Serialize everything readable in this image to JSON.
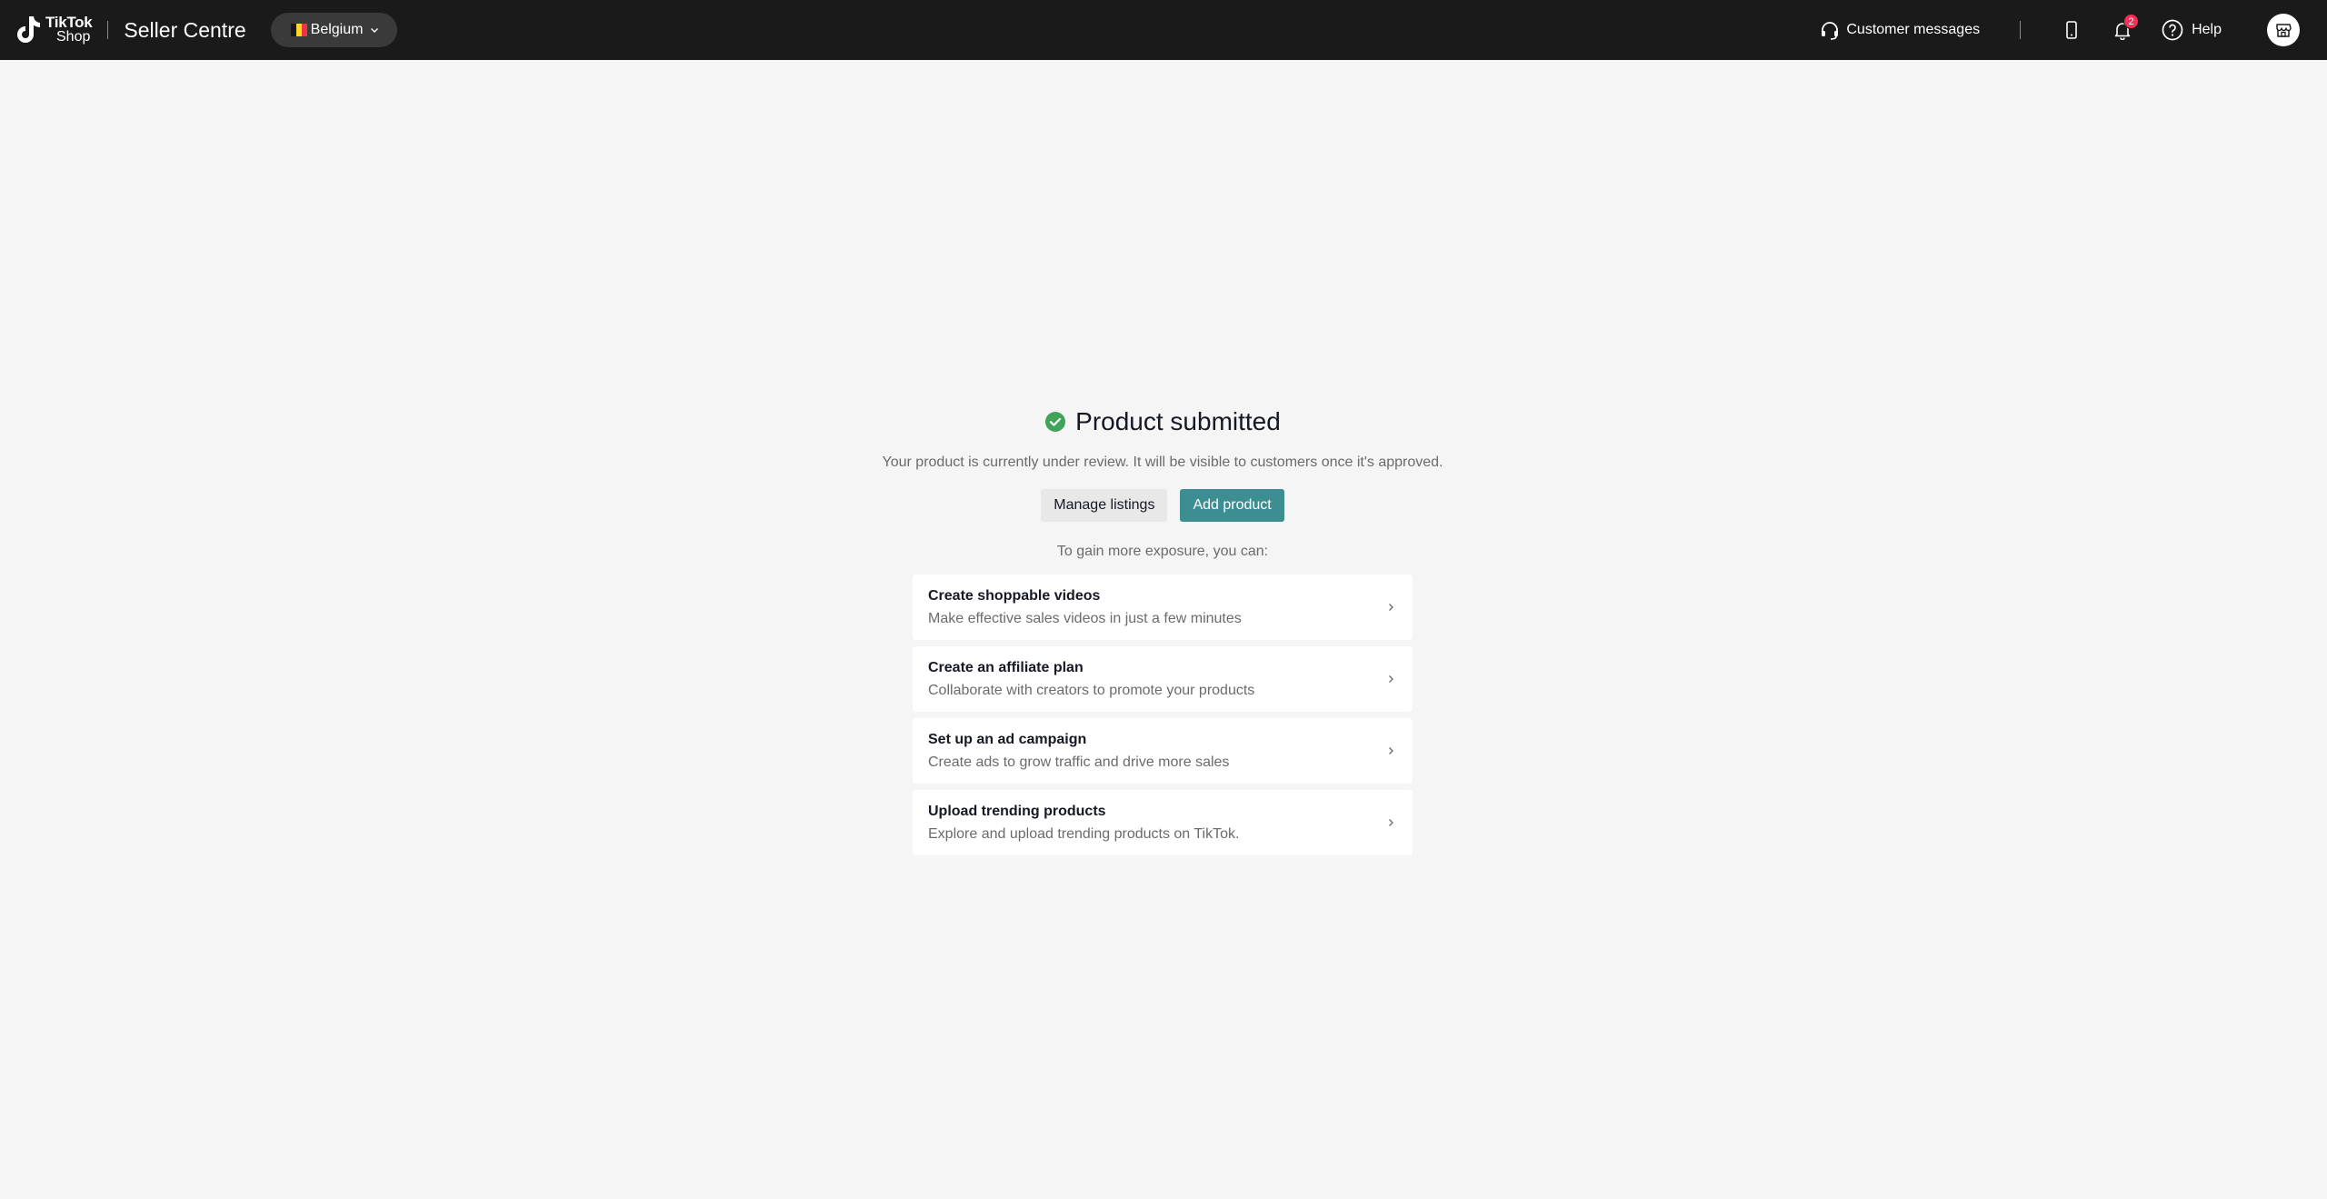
{
  "header": {
    "logo_line1": "TikTok",
    "logo_line2": "Shop",
    "title": "Seller Centre",
    "region": "Belgium",
    "customer_messages": "Customer messages",
    "notifications_count": "2",
    "help": "Help"
  },
  "main": {
    "title": "Product submitted",
    "subtitle": "Your product is currently under review. It will be visible to customers once it's approved.",
    "manage_listings": "Manage listings",
    "add_product": "Add product",
    "gain_text": "To gain more exposure, you can:",
    "options": [
      {
        "title": "Create shoppable videos",
        "desc": "Make effective sales videos in just a few minutes"
      },
      {
        "title": "Create an affiliate plan",
        "desc": "Collaborate with creators to promote your products"
      },
      {
        "title": "Set up an ad campaign",
        "desc": "Create ads to grow traffic and drive more sales"
      },
      {
        "title": "Upload trending products",
        "desc": "Explore and upload trending products on TikTok."
      }
    ]
  },
  "colors": {
    "topbar": "#1a1a1a",
    "primary_button": "#3d8e93",
    "success": "#3fa35a",
    "badge": "#fe2c55"
  }
}
